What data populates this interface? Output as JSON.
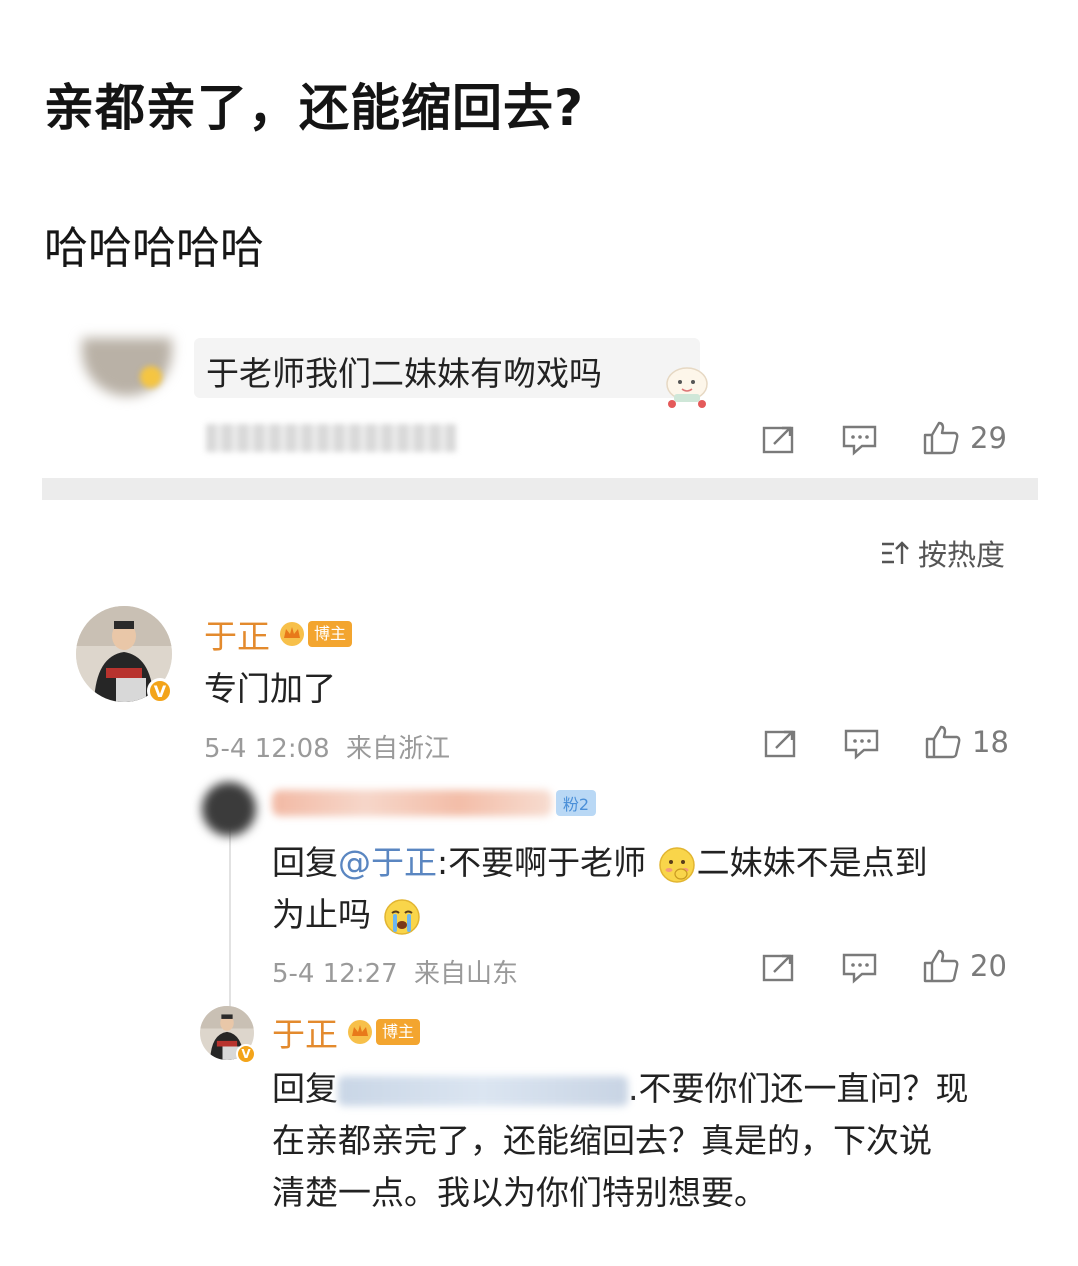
{
  "post": {
    "title": "亲都亲了，还能缩回去?",
    "subtitle": "哈哈哈哈哈"
  },
  "quoted_comment": {
    "text": "于老师我们二妹妹有吻戏吗",
    "likes": "29"
  },
  "sort": {
    "label": "按热度"
  },
  "comments": [
    {
      "user": "于正",
      "badge": "博主",
      "text": "专门加了",
      "time": "5-4 12:08",
      "location": "来自浙江",
      "likes": "18",
      "replies": [
        {
          "fan_badge": "粉2",
          "prefix": "回复",
          "mention": "@于正",
          "text_a": ":不要啊于老师",
          "text_b": "二妹妹不是点到",
          "text_c": "为止吗",
          "time": "5-4 12:27",
          "location": "来自山东",
          "likes": "20"
        },
        {
          "user": "于正",
          "badge": "博主",
          "prefix": "回复",
          "line1_rest": ".不要你们还一直问？现",
          "line2": "在亲都亲完了，还能缩回去？真是的，下次说",
          "line3": "清楚一点。我以为你们特别想要。"
        }
      ]
    }
  ],
  "icons": [
    "share-icon",
    "comment-icon",
    "like-icon",
    "sort-icon",
    "verified-icon",
    "crown-icon",
    "sticker-icon",
    "blush-emoji-icon",
    "cry-emoji-icon"
  ],
  "colors": {
    "username": "#e38a2d",
    "mention": "#5a86c1",
    "badge": "#f3a52f",
    "meta": "#9a9a9a"
  }
}
